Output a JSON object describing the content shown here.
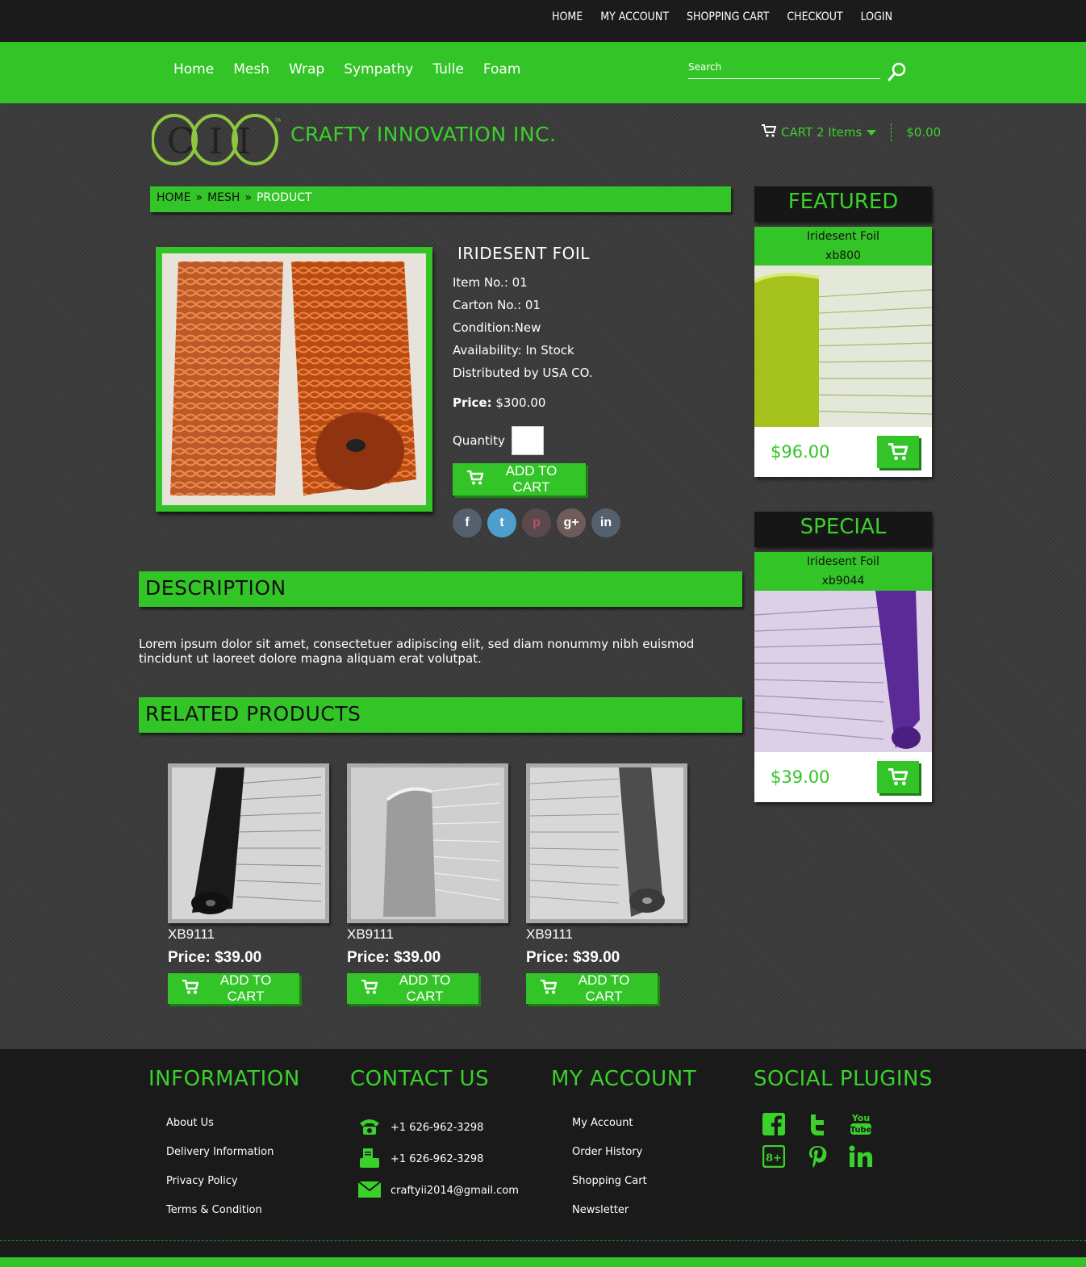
{
  "top_links": [
    "HOME",
    "MY ACCOUNT",
    "SHOPPING CART",
    "CHECKOUT",
    "LOGIN"
  ],
  "nav_menu": [
    "Home",
    "Mesh",
    "Wrap",
    "Sympathy",
    "Tulle",
    "Foam"
  ],
  "search": {
    "placeholder": "Search"
  },
  "brand": {
    "logo_text": "CII",
    "name": "CRAFTY INNOVATION INC."
  },
  "cart_summary": {
    "label": "CART 2 Items",
    "total": "$0.00"
  },
  "breadcrumb": {
    "home": "HOME",
    "sep": "»",
    "category": "MESH",
    "current": "PRODUCT"
  },
  "product": {
    "title": "IRIDESENT FOIL",
    "item_no": "Item No.: 01",
    "carton_no": "Carton No.: 01",
    "condition": "Condition:New",
    "availability": "Availability: In Stock",
    "distributed": "Distributed by USA CO.",
    "price_label": "Price:",
    "price_value": "$300.00",
    "quantity_label": "Quantity",
    "add_to_cart": "ADD TO CART",
    "social": [
      "f",
      "t",
      "p",
      "g+",
      "in"
    ]
  },
  "description": {
    "heading": "DESCRIPTION",
    "text": "Lorem ipsum dolor sit amet, consectetuer adipiscing elit, sed diam nonummy nibh euismod tincidunt ut laoreet dolore magna aliquam erat volutpat."
  },
  "related": {
    "heading": "RELATED PRODUCTS",
    "items": [
      {
        "code": "XB9111",
        "price_label": "Price:",
        "price": "$39.00",
        "button": "ADD TO CART"
      },
      {
        "code": "XB9111",
        "price_label": "Price:",
        "price": "$39.00",
        "button": "ADD TO CART"
      },
      {
        "code": "XB9111",
        "price_label": "Price:",
        "price": "$39.00",
        "button": "ADD TO CART"
      }
    ]
  },
  "sidebar": {
    "featured": {
      "heading": "FEATURED",
      "name": "Iridesent Foil",
      "code": "xb800",
      "price": "$96.00"
    },
    "special": {
      "heading": "SPECIAL",
      "name": "Iridesent Foil",
      "code": "xb9044",
      "price": "$39.00"
    }
  },
  "footer": {
    "information": {
      "heading": "INFORMATION",
      "links": [
        "About Us",
        "Delivery Information",
        "Privacy Policy",
        "Terms & Condition"
      ]
    },
    "contact": {
      "heading": "CONTACT US",
      "phone": "+1 626-962-3298",
      "fax": "+1 626-962-3298",
      "email": "craftyii2014@gmail.com"
    },
    "account": {
      "heading": "MY ACCOUNT",
      "links": [
        "My Account",
        "Order History",
        "Shopping Cart",
        "Newsletter"
      ]
    },
    "social": {
      "heading": "SOCIAL PLUGINS",
      "icons": [
        "facebook-icon",
        "twitter-icon",
        "youtube-icon",
        "googleplus-icon",
        "pinterest-icon",
        "linkedin-icon"
      ]
    }
  },
  "colors": {
    "accent": "#33c527",
    "dark": "#1b1b1b",
    "background": "#3a3a3a"
  }
}
